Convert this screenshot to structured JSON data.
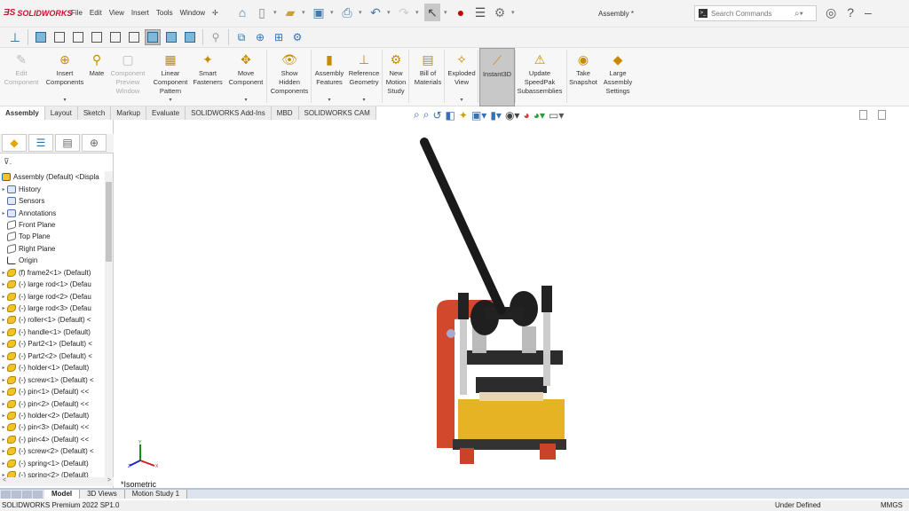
{
  "app": {
    "brand": "SOLIDWORKS",
    "doc_title": "Assembly *"
  },
  "menu": [
    "File",
    "Edit",
    "View",
    "Insert",
    "Tools",
    "Window"
  ],
  "search": {
    "placeholder": "Search Commands"
  },
  "ribbon": [
    {
      "label": "Edit Component",
      "disabled": true
    },
    {
      "label": "Insert Components",
      "dropdown": true
    },
    {
      "label": "Mate"
    },
    {
      "label": "Component Preview Window",
      "disabled": true
    },
    {
      "label": "Linear Component Pattern",
      "dropdown": true
    },
    {
      "label": "Smart Fasteners"
    },
    {
      "label": "Move Component",
      "dropdown": true
    },
    {
      "label": "Show Hidden Components"
    },
    {
      "label": "Assembly Features",
      "dropdown": true
    },
    {
      "label": "Reference Geometry",
      "dropdown": true
    },
    {
      "label": "New Motion Study"
    },
    {
      "label": "Bill of Materials"
    },
    {
      "label": "Exploded View",
      "dropdown": true
    },
    {
      "label": "Instant3D",
      "active": true
    },
    {
      "label": "Update SpeedPak Subassemblies"
    },
    {
      "label": "Take Snapshot"
    },
    {
      "label": "Large Assembly Settings"
    }
  ],
  "tabs": [
    "Assembly",
    "Layout",
    "Sketch",
    "Markup",
    "Evaluate",
    "SOLIDWORKS Add-Ins",
    "MBD",
    "SOLIDWORKS CAM"
  ],
  "active_tab": "Assembly",
  "tree": [
    {
      "label": "Assembly (Default) <Displa",
      "icon": "asm",
      "arrow": false
    },
    {
      "label": "History",
      "icon": "feat",
      "arrow": true
    },
    {
      "label": "Sensors",
      "icon": "feat",
      "arrow": false
    },
    {
      "label": "Annotations",
      "icon": "feat",
      "arrow": true
    },
    {
      "label": "Front Plane",
      "icon": "plane",
      "arrow": false
    },
    {
      "label": "Top Plane",
      "icon": "plane",
      "arrow": false
    },
    {
      "label": "Right Plane",
      "icon": "plane",
      "arrow": false
    },
    {
      "label": "Origin",
      "icon": "origin",
      "arrow": false
    },
    {
      "label": "(f) frame2<1> (Default)",
      "icon": "part",
      "arrow": true
    },
    {
      "label": "(-) large rod<1> (Defau",
      "icon": "part",
      "arrow": true
    },
    {
      "label": "(-) large rod<2> (Defau",
      "icon": "part",
      "arrow": true
    },
    {
      "label": "(-) large rod<3> (Defau",
      "icon": "part",
      "arrow": true
    },
    {
      "label": "(-) roller<1> (Default) <",
      "icon": "part",
      "arrow": true
    },
    {
      "label": "(-) handle<1> (Default)",
      "icon": "part",
      "arrow": true
    },
    {
      "label": "(-) Part2<1> (Default) <",
      "icon": "part",
      "arrow": true
    },
    {
      "label": "(-) Part2<2> (Default) <",
      "icon": "part",
      "arrow": true
    },
    {
      "label": "(-) holder<1> (Default)",
      "icon": "part",
      "arrow": true
    },
    {
      "label": "(-) screw<1> (Default) <",
      "icon": "part",
      "arrow": true
    },
    {
      "label": "(-) pin<1> (Default) <<",
      "icon": "part",
      "arrow": true
    },
    {
      "label": "(-) pin<2> (Default) <<",
      "icon": "part",
      "arrow": true
    },
    {
      "label": "(-) holder<2> (Default)",
      "icon": "part",
      "arrow": true
    },
    {
      "label": "(-) pin<3> (Default) <<",
      "icon": "part",
      "arrow": true
    },
    {
      "label": "(-) pin<4> (Default) <<",
      "icon": "part",
      "arrow": true
    },
    {
      "label": "(-) screw<2> (Default) <",
      "icon": "part",
      "arrow": true
    },
    {
      "label": "(-) spring<1> (Default)",
      "icon": "part",
      "arrow": true
    },
    {
      "label": "(-) spring<2> (Default)",
      "icon": "part",
      "arrow": true
    }
  ],
  "bottom_tabs": [
    "Model",
    "3D Views",
    "Motion Study 1"
  ],
  "active_bottom_tab": "Model",
  "viewport": {
    "view_label": "*Isometric",
    "triad": {
      "x": "X",
      "y": "Y",
      "z": "Z"
    }
  },
  "status": {
    "version": "SOLIDWORKS Premium 2022 SP1.0",
    "state": "Under Defined",
    "units": "MMGS"
  }
}
